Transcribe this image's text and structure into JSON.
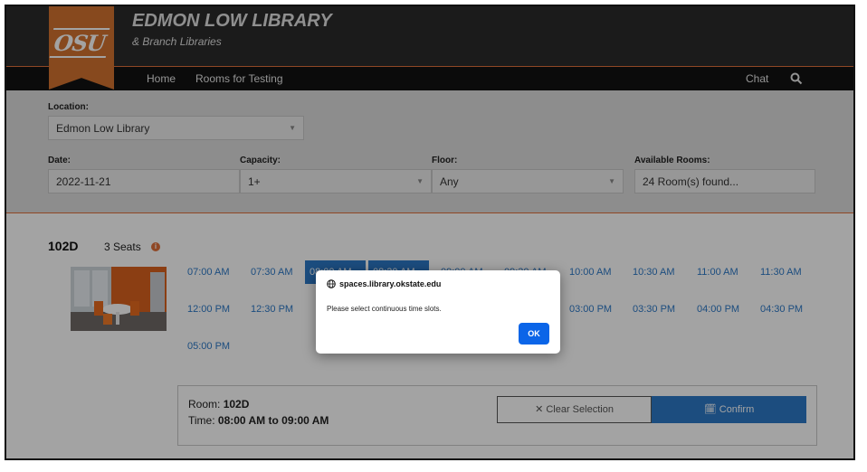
{
  "header": {
    "logo_text": "OSU",
    "title": "EDMON LOW LIBRARY",
    "subtitle": "& Branch Libraries",
    "colors": {
      "bar": "#2b2b2b",
      "accent": "#d3722f"
    }
  },
  "nav": {
    "home": "Home",
    "rooms_for_testing": "Rooms for Testing",
    "chat": "Chat",
    "search_icon": "search-icon"
  },
  "filters": {
    "location_label": "Location:",
    "location_value": "Edmon Low Library",
    "date_label": "Date:",
    "date_value": "2022-11-21",
    "capacity_label": "Capacity:",
    "capacity_value": "1+",
    "floor_label": "Floor:",
    "floor_value": "Any",
    "available_label": "Available Rooms:",
    "available_value": "24 Room(s) found..."
  },
  "room": {
    "name": "102D",
    "seats": "3 Seats",
    "info_icon": "info-icon",
    "slots": [
      {
        "time": "07:00 AM",
        "selected": false
      },
      {
        "time": "07:30 AM",
        "selected": false
      },
      {
        "time": "08:00 AM",
        "selected": true
      },
      {
        "time": "08:30 AM",
        "selected": true
      },
      {
        "time": "09:00 AM",
        "selected": false
      },
      {
        "time": "09:30 AM",
        "selected": false
      },
      {
        "time": "10:00 AM",
        "selected": false
      },
      {
        "time": "10:30 AM",
        "selected": false
      },
      {
        "time": "11:00 AM",
        "selected": false
      },
      {
        "time": "11:30 AM",
        "selected": false
      },
      {
        "time": "12:00 PM",
        "selected": false
      },
      {
        "time": "12:30 PM",
        "selected": false
      },
      {
        "time": "03:00 PM",
        "selected": false
      },
      {
        "time": "03:30 PM",
        "selected": false
      },
      {
        "time": "04:00 PM",
        "selected": false
      },
      {
        "time": "04:30 PM",
        "selected": false
      },
      {
        "time": "05:00 PM",
        "selected": false
      }
    ]
  },
  "summary": {
    "room_label": "Room:",
    "room_value": "102D",
    "time_label": "Time:",
    "time_value": "08:00 AM to 09:00 AM",
    "clear_label": "Clear Selection",
    "confirm_label": "Confirm"
  },
  "dialog": {
    "origin": "spaces.library.okstate.edu",
    "message": "Please select continuous time slots.",
    "ok_label": "OK"
  }
}
